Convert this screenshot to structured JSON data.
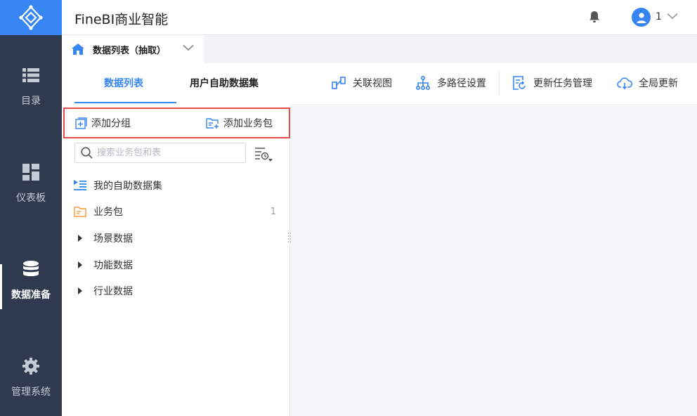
{
  "header": {
    "app_title": "FineBI商业智能",
    "user_name": "1"
  },
  "nav": {
    "items": [
      {
        "label": "目录",
        "icon": "list-icon"
      },
      {
        "label": "仪表板",
        "icon": "dashboard-icon"
      },
      {
        "label": "数据准备",
        "icon": "database-icon",
        "active": true
      },
      {
        "label": "管理系统",
        "icon": "gear-icon"
      }
    ]
  },
  "tab": {
    "label": "数据列表（抽取）"
  },
  "subtabs": {
    "data_list": "数据列表",
    "self_service": "用户自助数据集"
  },
  "toolbar": {
    "relation_view": "关联视图",
    "multi_path": "多路径设置",
    "update_task": "更新任务管理",
    "global_update": "全局更新"
  },
  "panel": {
    "add_group": "添加分组",
    "add_package": "添加业务包",
    "search_placeholder": "搜索业务包和表",
    "tree": [
      {
        "label": "我的自助数据集",
        "icon": "self-dataset-icon"
      },
      {
        "label": "业务包",
        "icon": "folder-icon",
        "count": "1"
      },
      {
        "label": "场景数据",
        "icon": "caret-right-icon"
      },
      {
        "label": "功能数据",
        "icon": "caret-right-icon"
      },
      {
        "label": "行业数据",
        "icon": "caret-right-icon"
      }
    ]
  },
  "colors": {
    "accent": "#3685f2",
    "nav_bg": "#2f3a4f",
    "highlight": "#e84a4a"
  }
}
